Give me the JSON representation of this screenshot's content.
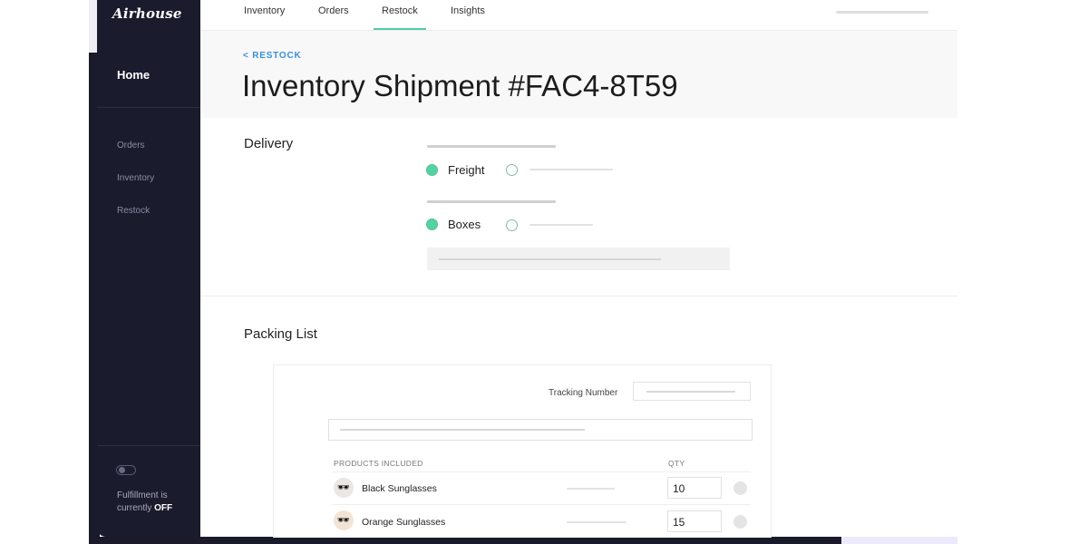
{
  "brand": {
    "name": "Airhouse"
  },
  "sidebar": {
    "home": "Home",
    "items": [
      "Orders",
      "Inventory",
      "Restock"
    ],
    "fulfillment_text": "Fulfillment is currently",
    "fulfillment_state": "OFF"
  },
  "topnav": {
    "tabs": [
      "Inventory",
      "Orders",
      "Restock",
      "Insights"
    ],
    "active": "Restock"
  },
  "page": {
    "breadcrumb": "< RESTOCK",
    "title": "Inventory Shipment #FAC4-8T59"
  },
  "delivery": {
    "title": "Delivery",
    "option1": "Freight",
    "option2": "Boxes"
  },
  "packing": {
    "title": "Packing List",
    "tracking_label": "Tracking Number",
    "col_products": "PRODUCTS INCLUDED",
    "col_qty": "QTY",
    "rows": [
      {
        "name": "Black Sunglasses",
        "qty": "10",
        "icon": "sunglasses-icon"
      },
      {
        "name": "Orange Sunglasses",
        "qty": "15",
        "icon": "sunglasses-icon"
      }
    ]
  },
  "colors": {
    "sidebar": "#1b1b2e",
    "accent": "#4fcf9f",
    "link": "#3a8fd8"
  }
}
